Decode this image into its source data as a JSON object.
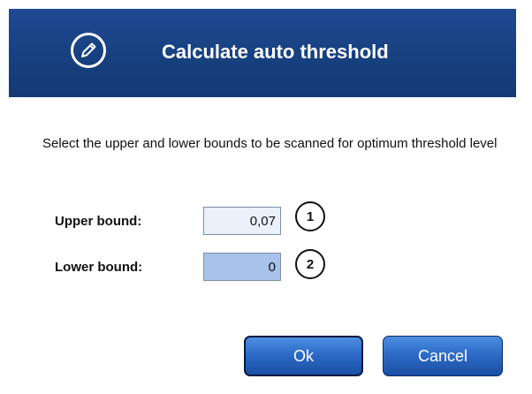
{
  "dialog": {
    "title": "Calculate auto threshold",
    "icon": "pencil-icon",
    "instructions": "Select the upper and lower bounds to be scanned for optimum threshold level"
  },
  "fields": {
    "upper": {
      "label": "Upper bound:",
      "value": "0,07",
      "callout": "1"
    },
    "lower": {
      "label": "Lower bound:",
      "value": "0",
      "callout": "2"
    }
  },
  "buttons": {
    "ok": "Ok",
    "cancel": "Cancel"
  },
  "colors": {
    "header": "#17407f",
    "upper_input_bg": "#ebf1fb",
    "lower_input_bg": "#a8c2ea",
    "button": "#2d6bc7"
  }
}
